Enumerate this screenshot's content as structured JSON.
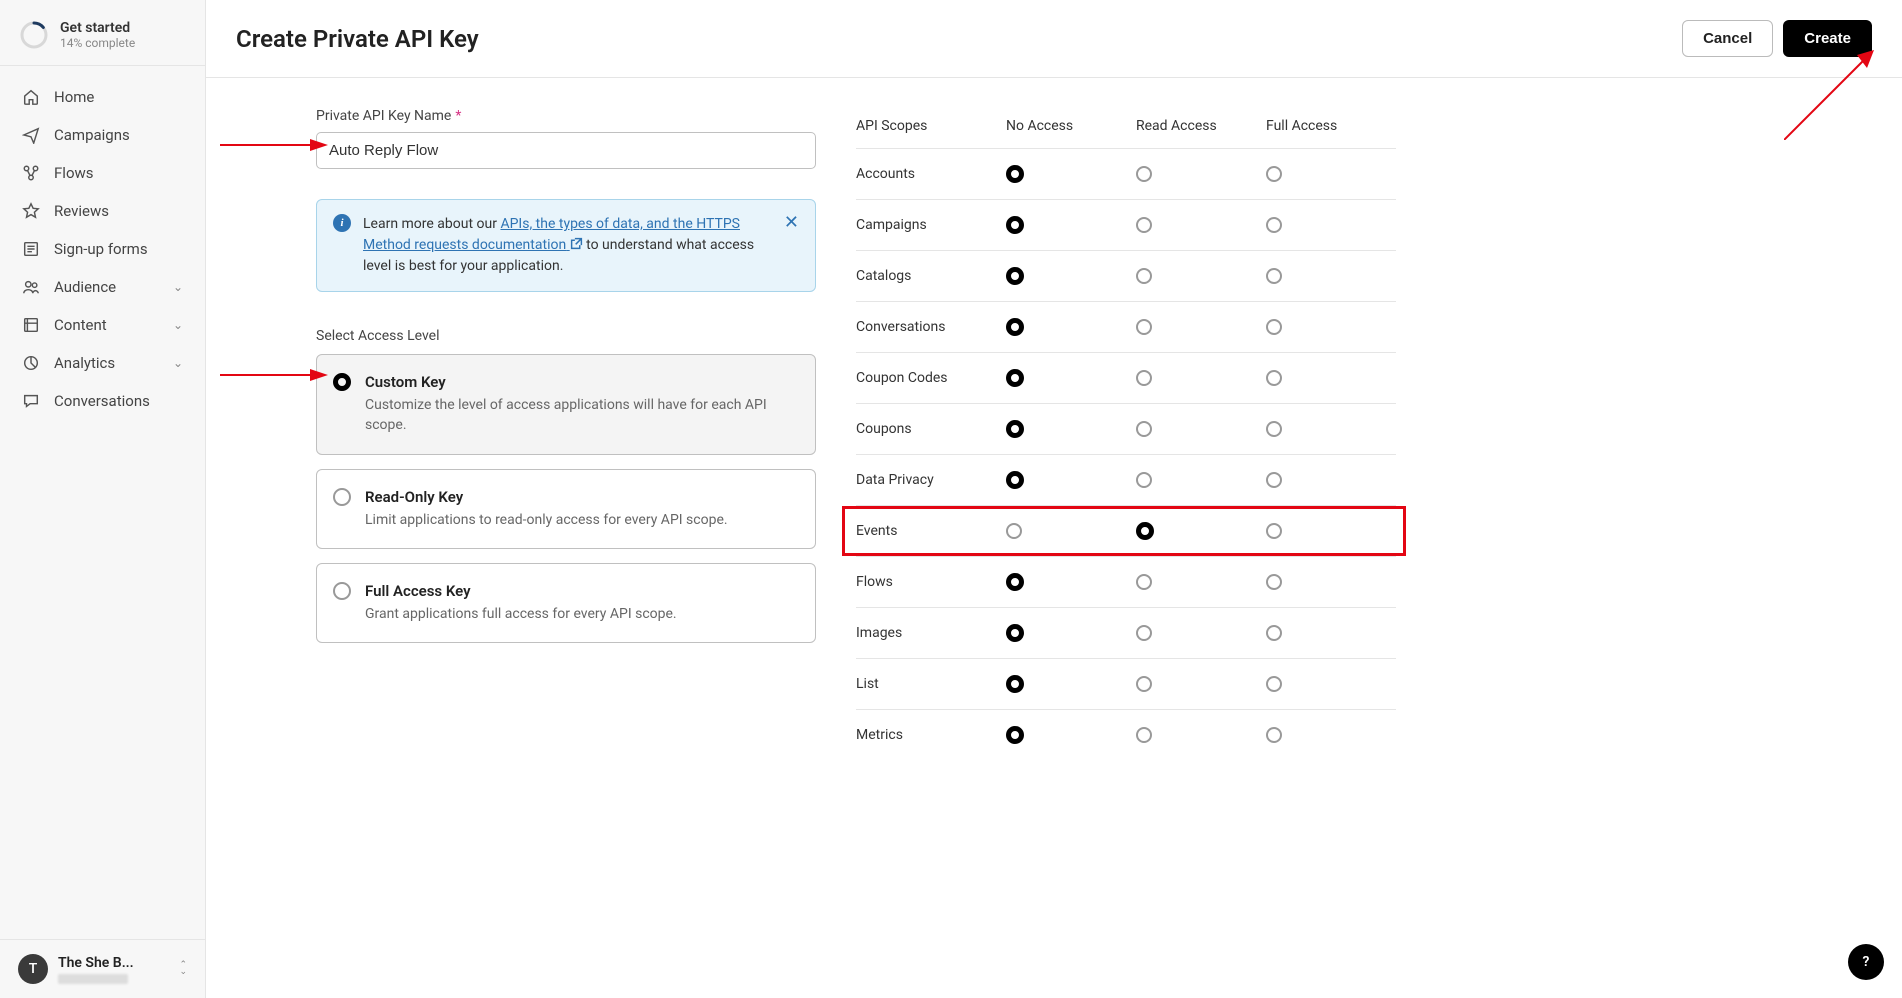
{
  "sidebar": {
    "getStarted": {
      "title": "Get started",
      "sub": "14% complete",
      "percent": 14
    },
    "items": [
      {
        "label": "Home",
        "icon": "home"
      },
      {
        "label": "Campaigns",
        "icon": "send"
      },
      {
        "label": "Flows",
        "icon": "flows"
      },
      {
        "label": "Reviews",
        "icon": "star"
      },
      {
        "label": "Sign-up forms",
        "icon": "form"
      },
      {
        "label": "Audience",
        "icon": "people",
        "chevron": true
      },
      {
        "label": "Content",
        "icon": "content",
        "chevron": true
      },
      {
        "label": "Analytics",
        "icon": "pie",
        "chevron": true
      },
      {
        "label": "Conversations",
        "icon": "chat"
      }
    ],
    "org": {
      "initial": "T",
      "name": "The She B..."
    }
  },
  "header": {
    "title": "Create Private API Key",
    "cancel": "Cancel",
    "create": "Create"
  },
  "form": {
    "nameLabel": "Private API Key Name",
    "nameValue": "Auto Reply Flow",
    "info": {
      "pre": "Learn more about our ",
      "link": "APIs, the types of data, and the HTTPS Method requests documentation",
      "post": " to understand what access level is best for your application."
    },
    "accessLabel": "Select Access Level",
    "options": [
      {
        "title": "Custom Key",
        "desc": "Customize the level of access applications will have for each API scope.",
        "selected": true
      },
      {
        "title": "Read-Only Key",
        "desc": "Limit applications to read-only access for every API scope.",
        "selected": false
      },
      {
        "title": "Full Access Key",
        "desc": "Grant applications full access for every API scope.",
        "selected": false
      }
    ]
  },
  "scopes": {
    "header": {
      "name": "API Scopes",
      "none": "No Access",
      "read": "Read Access",
      "full": "Full Access"
    },
    "rows": [
      {
        "name": "Accounts",
        "sel": 0
      },
      {
        "name": "Campaigns",
        "sel": 0
      },
      {
        "name": "Catalogs",
        "sel": 0
      },
      {
        "name": "Conversations",
        "sel": 0
      },
      {
        "name": "Coupon Codes",
        "sel": 0
      },
      {
        "name": "Coupons",
        "sel": 0
      },
      {
        "name": "Data Privacy",
        "sel": 0
      },
      {
        "name": "Events",
        "sel": 1,
        "highlight": true
      },
      {
        "name": "Flows",
        "sel": 0
      },
      {
        "name": "Images",
        "sel": 0
      },
      {
        "name": "List",
        "sel": 0
      },
      {
        "name": "Metrics",
        "sel": 0
      }
    ]
  },
  "fab": "?"
}
